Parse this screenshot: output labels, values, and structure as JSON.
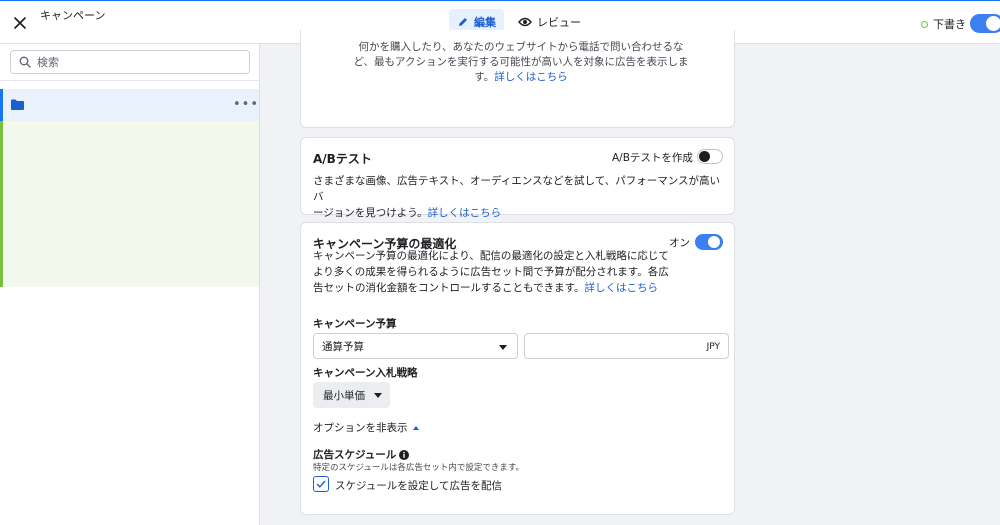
{
  "topbar": {
    "title": "キャンペーン",
    "tabs": {
      "edit": "編集",
      "review": "レビュー"
    },
    "draft_label": "下書き"
  },
  "sidebar": {
    "search_placeholder": "検索"
  },
  "card_objective": {
    "text": "何かを購入したり、あなたのウェブサイトから電話で問い合わせるなど、最も アクションを実行する可能性が高い人を対象に広告を表示します。",
    "line1": "何かを購入したり、あなたのウェブサイトから電話で問い合わせるな",
    "line2": "ど、最もアクションを実行する可能性が高い人を対象に広告を表示しま",
    "line3": "す。",
    "learn_more": "詳しくはこちら"
  },
  "card_ab": {
    "title": "A/Bテスト",
    "toggle_label": "A/Bテストを作成",
    "line1": "さまざまな画像、広告テキスト、オーディエンスなどを試して、パフォーマンスが高いバ",
    "line2": "ージョンを見つけよう。",
    "learn_more": "詳しくはこちら"
  },
  "card_budget": {
    "title": "キャンペーン予算の最適化",
    "toggle_label": "オン",
    "line1": "キャンペーン予算の最適化により、配信の最適化の設定と入札戦略に応じて",
    "line2": "より多くの成果を得られるように広告セット間で予算が配分されます。各広",
    "line3": "告セットの消化金額をコントロールすることもできます。",
    "learn_more": "詳しくはこちら",
    "budget_label": "キャンペーン予算",
    "budget_type": "通算予算",
    "currency": "JPY",
    "bid_label": "キャンペーン入札戦略",
    "bid_value": "最小単価",
    "hide_options": "オプションを非表示",
    "schedule_label": "広告スケジュール",
    "schedule_note": "特定のスケジュールは各広告セット内で設定できます。",
    "schedule_checkbox": "スケジュールを設定して広告を配信"
  }
}
